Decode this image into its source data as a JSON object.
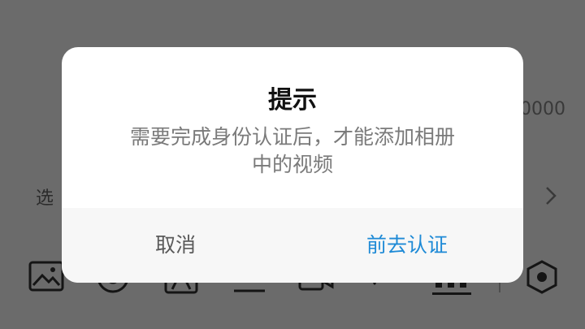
{
  "background": {
    "count_text": "0000",
    "select_text": "选"
  },
  "toolbar": {
    "icons": [
      "image-icon",
      "camera-icon",
      "portrait-icon",
      "text-icon",
      "video-icon",
      "link-icon",
      "grid-icon",
      "settings-icon"
    ]
  },
  "dialog": {
    "title": "提示",
    "message": "需要完成身份认证后，才能添加相册中的视频",
    "cancel_label": "取消",
    "confirm_label": "前去认证"
  },
  "colors": {
    "accent": "#1e8ad6",
    "overlay": "#000000",
    "dialog_bg": "#ffffff",
    "footer_bg": "#f7f7f7"
  }
}
